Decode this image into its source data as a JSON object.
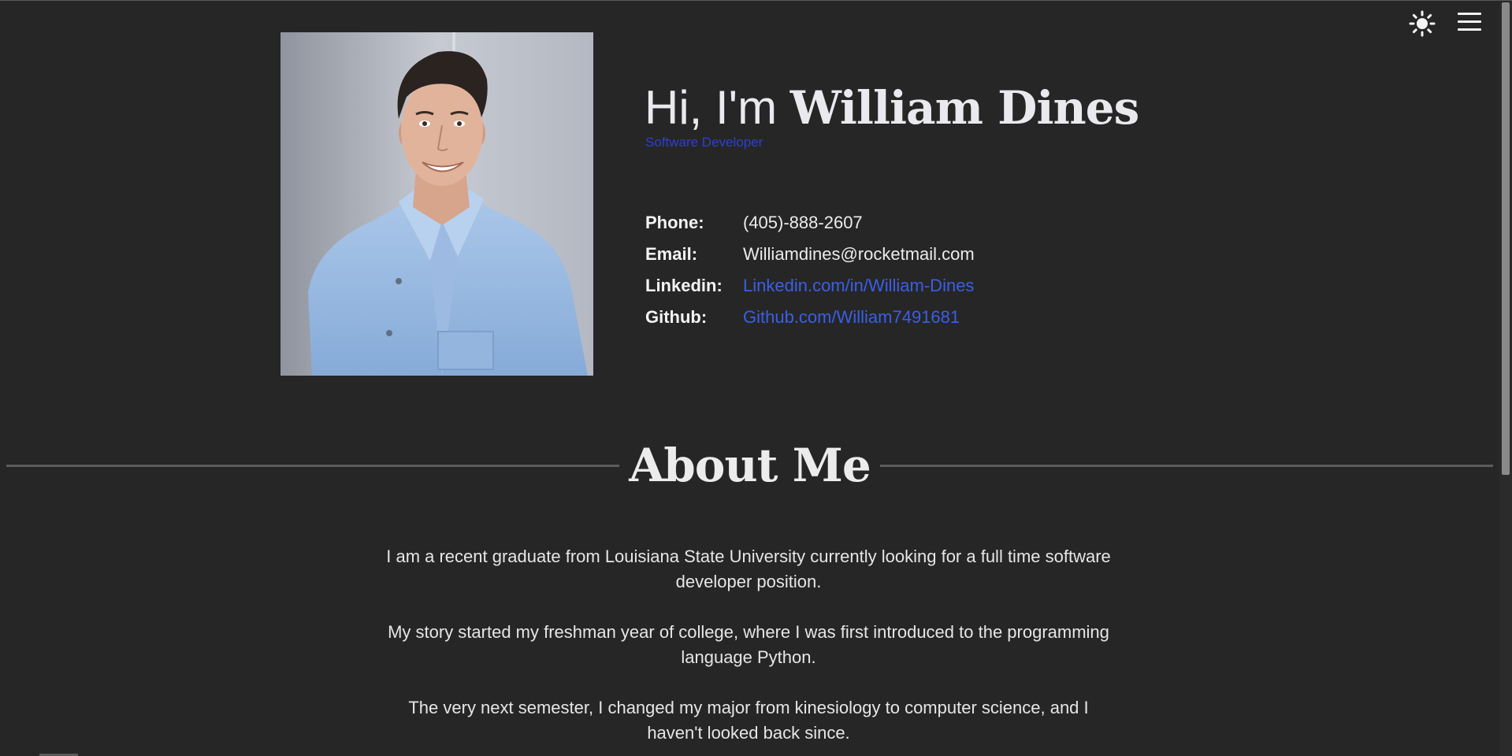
{
  "header": {
    "theme_toggle_icon": "sun-icon",
    "menu_icon": "hamburger-menu-icon"
  },
  "hero": {
    "greeting_prefix": "Hi, I'm ",
    "name": "William Dines",
    "role": "Software Developer",
    "photo_subject": "portrait-photo",
    "contact": [
      {
        "label": "Phone:",
        "value": "(405)-888-2607",
        "is_link": false
      },
      {
        "label": "Email:",
        "value": "Williamdines@rocketmail.com",
        "is_link": false
      },
      {
        "label": "Linkedin:",
        "value": "Linkedin.com/in/William-Dines",
        "is_link": true
      },
      {
        "label": "Github:",
        "value": "Github.com/William7491681",
        "is_link": true
      }
    ]
  },
  "about": {
    "title": "About Me",
    "paragraphs": [
      "I am a recent graduate from Louisiana State University currently looking for a full time software developer position.",
      "My story started my freshman year of college, where I was first introduced to the programming language Python.",
      "The very next semester, I changed my major from kinesiology to computer science, and I haven't looked back since."
    ]
  },
  "colors": {
    "background": "#262626",
    "text": "#e8e8e8",
    "accent_link": "#3a5fe6",
    "role_text": "#2f3fd0",
    "divider": "#5c5c5c"
  }
}
